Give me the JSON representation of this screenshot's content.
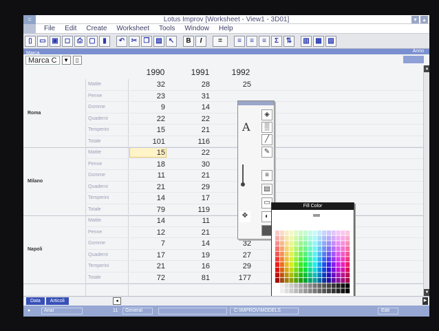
{
  "window": {
    "title": "Lotus Improv  [Worksheet - View1 - 3D01]",
    "system_menu": "="
  },
  "menu": [
    "File",
    "Edit",
    "Create",
    "Worksheet",
    "Tools",
    "Window",
    "Help"
  ],
  "toolbar": {
    "bold_label": "B",
    "italic_label": "I",
    "equals_label": "="
  },
  "namebar": {
    "left": "Marca",
    "right": "Anno"
  },
  "cellbar": {
    "name": "Marca C",
    "arrow": "▼"
  },
  "columns": [
    "1990",
    "1991",
    "1992"
  ],
  "groups": [
    {
      "region": "Roma",
      "rows": [
        {
          "label": "Matite",
          "values": [
            "32",
            "28",
            "25"
          ]
        },
        {
          "label": "Penne",
          "values": [
            "23",
            "31",
            ""
          ]
        },
        {
          "label": "Gomme",
          "values": [
            "9",
            "14",
            ""
          ]
        },
        {
          "label": "Quaderni",
          "values": [
            "22",
            "22",
            ""
          ]
        },
        {
          "label": "Temperini",
          "values": [
            "15",
            "21",
            ""
          ]
        },
        {
          "label": "Totale",
          "values": [
            "101",
            "116",
            ""
          ]
        }
      ]
    },
    {
      "region": "Milano",
      "rows": [
        {
          "label": "Matite",
          "values": [
            "15",
            "22",
            ""
          ]
        },
        {
          "label": "Penne",
          "values": [
            "18",
            "30",
            ""
          ]
        },
        {
          "label": "Gomme",
          "values": [
            "11",
            "21",
            ""
          ]
        },
        {
          "label": "Quaderni",
          "values": [
            "21",
            "29",
            ""
          ]
        },
        {
          "label": "Temperini",
          "values": [
            "14",
            "17",
            ""
          ]
        },
        {
          "label": "Totale",
          "values": [
            "79",
            "119",
            ""
          ]
        }
      ]
    },
    {
      "region": "Napoli",
      "rows": [
        {
          "label": "Matite",
          "values": [
            "14",
            "11",
            ""
          ]
        },
        {
          "label": "Penne",
          "values": [
            "12",
            "21",
            "40"
          ]
        },
        {
          "label": "Gomme",
          "values": [
            "7",
            "14",
            "32"
          ]
        },
        {
          "label": "Quaderni",
          "values": [
            "17",
            "19",
            "27"
          ]
        },
        {
          "label": "Temperini",
          "values": [
            "21",
            "16",
            "29"
          ]
        },
        {
          "label": "Totale",
          "values": [
            "72",
            "81",
            "177"
          ]
        }
      ]
    }
  ],
  "palette": {
    "letter": "A"
  },
  "fill_color": {
    "title": "Fill Color"
  },
  "sheet_tabs": [
    "Data",
    "Articoli"
  ],
  "status": {
    "font": "Arial",
    "size": "11",
    "format": "General",
    "path": "C:\\IMPROV\\MODELS",
    "mode": "Edit"
  },
  "colors": {
    "title_text": "#4a4b78",
    "selected_cell": "#fff3c8",
    "status_bar": "#96a7d3",
    "name_bar": "#7a8fd0"
  }
}
